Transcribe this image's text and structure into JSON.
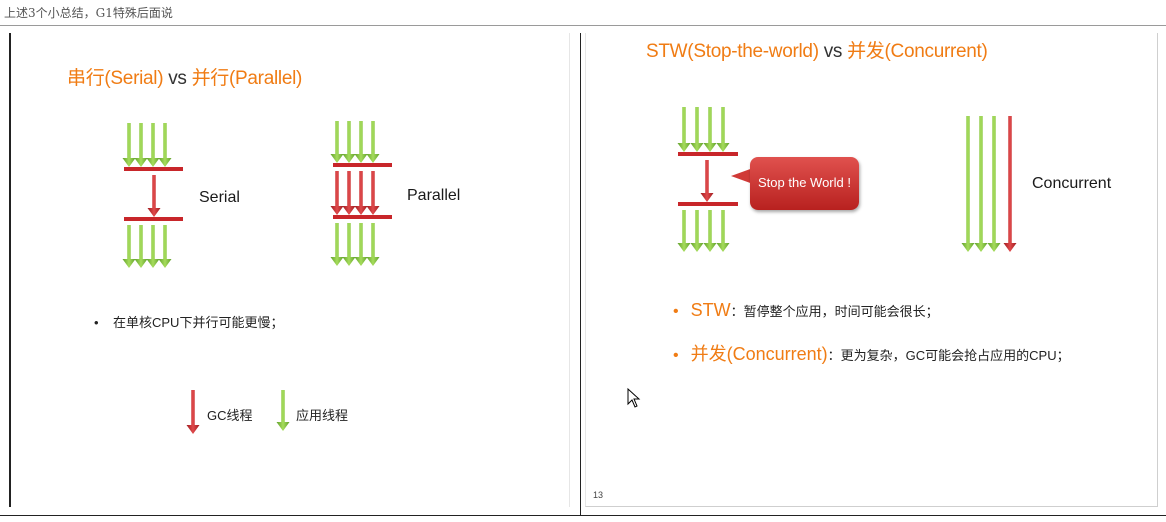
{
  "header": {
    "caption": "上述3个小总结，G1特殊后面说"
  },
  "left_slide": {
    "title_part1": "串行(Serial)",
    "title_vs": "vs",
    "title_part2": "并行(Parallel)",
    "serial_label": "Serial",
    "parallel_label": "Parallel",
    "bullet": "在单核CPU下并行可能更慢；",
    "legend_gc": "GC线程",
    "legend_app": "应用线程"
  },
  "right_slide": {
    "title_part1": "STW(Stop-the-world)",
    "title_vs": "vs",
    "title_part2": "并发(Concurrent)",
    "bubble_text": "Stop the World !",
    "concurrent_label": "Concurrent",
    "bullet1_kw": "STW",
    "bullet1_text": "：暂停整个应用，时间可能会很长；",
    "bullet2_kw": "并发(Concurrent)",
    "bullet2_text": "：更为复杂，GC可能会抢占应用的CPU；",
    "page_number": "13"
  },
  "colors": {
    "accent_orange": "#f07c14",
    "gc_red": "#c8262a",
    "app_green": "#7cc23a"
  },
  "icons": {
    "green_arrow": "app-thread-arrow-icon",
    "red_arrow": "gc-thread-arrow-icon",
    "cursor": "mouse-cursor-icon"
  }
}
